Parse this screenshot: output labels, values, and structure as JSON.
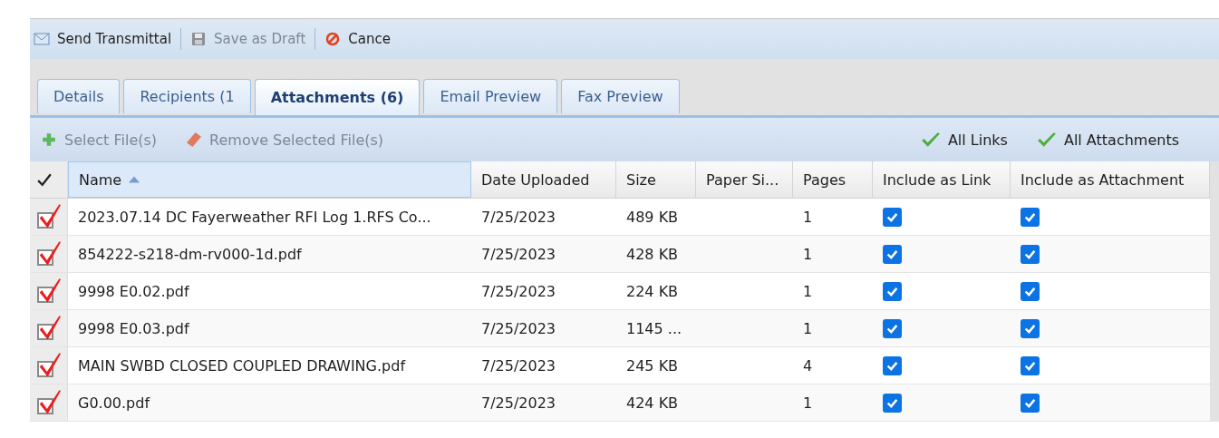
{
  "toolbar": [
    {
      "label": "Send Transmittal",
      "disabled": false
    },
    {
      "label": "Save as Draft",
      "disabled": true
    },
    {
      "label": "Cance",
      "disabled": false
    }
  ],
  "tabs": [
    {
      "label": "Details",
      "selected": false
    },
    {
      "label": "Recipients (1",
      "selected": false
    },
    {
      "label": "Attachments (6)",
      "selected": true
    },
    {
      "label": "Email Preview",
      "selected": false
    },
    {
      "label": "Fax Preview",
      "selected": false
    }
  ],
  "file_toolbar": {
    "left": [
      {
        "label": "Select File(s)",
        "disabled": true
      },
      {
        "label": "Remove Selected File(s)",
        "disabled": true
      }
    ],
    "right": [
      {
        "label": "All Links"
      },
      {
        "label": "All Attachments"
      }
    ]
  },
  "table": {
    "columns": [
      "Name",
      "Date Uploaded",
      "Size",
      "Paper Si...",
      "Pages",
      "Include as Link",
      "Include as Attachment"
    ],
    "rows": [
      {
        "checked": true,
        "name": "2023.07.14 DC Fayerweather RFI Log 1.RFS Co...",
        "date": "7/25/2023",
        "size": "489 KB",
        "pages": "1",
        "link": true,
        "attachment": true
      },
      {
        "checked": true,
        "name": "854222-s218-dm-rv000-1d.pdf",
        "date": "7/25/2023",
        "size": "428 KB",
        "pages": "1",
        "link": true,
        "attachment": true
      },
      {
        "checked": true,
        "name": "9998 E0.02.pdf",
        "date": "7/25/2023",
        "size": "224 KB",
        "pages": "1",
        "link": true,
        "attachment": true
      },
      {
        "checked": true,
        "name": "9998 E0.03.pdf",
        "date": "7/25/2023",
        "size": "1145 ...",
        "pages": "1",
        "link": true,
        "attachment": true
      },
      {
        "checked": true,
        "name": "MAIN SWBD CLOSED COUPLED DRAWING.pdf",
        "date": "7/25/2023",
        "size": "245 KB",
        "pages": "4",
        "link": true,
        "attachment": true
      },
      {
        "checked": true,
        "name": "G0.00.pdf",
        "date": "7/25/2023",
        "size": "424 KB",
        "pages": "1",
        "link": true,
        "attachment": true
      }
    ]
  }
}
